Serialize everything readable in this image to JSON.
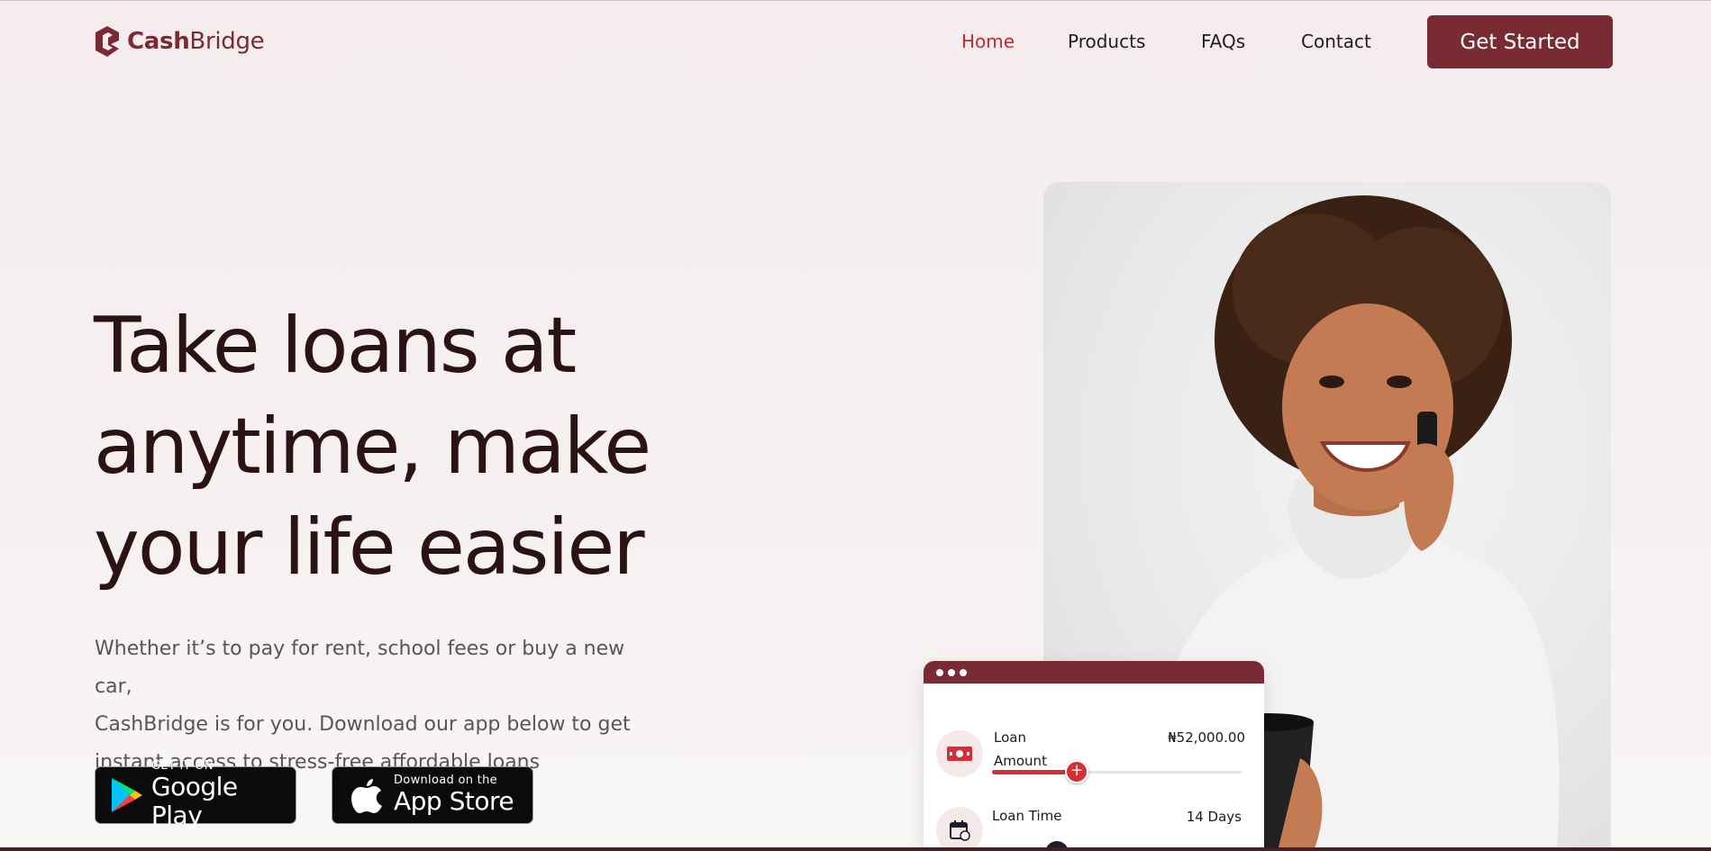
{
  "brand": {
    "bold": "Cash",
    "light": "Bridge"
  },
  "nav": {
    "items": [
      {
        "label": "Home",
        "active": true
      },
      {
        "label": "Products",
        "active": false
      },
      {
        "label": "FAQs",
        "active": false
      },
      {
        "label": "Contact",
        "active": false
      }
    ],
    "cta_label": "Get Started"
  },
  "hero": {
    "title_lines": [
      "Take loans at",
      "anytime, make",
      "your life easier"
    ],
    "subtitle_lines": [
      "Whether it’s to pay for rent, school fees or buy a new car,",
      "CashBridge is for you. Download our app below to get",
      "instant access to stress-free affordable loans"
    ]
  },
  "stores": {
    "google": {
      "small": "GET IT ON",
      "big": "Google Play"
    },
    "apple": {
      "small": "Download on the",
      "big": "App Store"
    }
  },
  "loan_card": {
    "loan_label": "Loan",
    "amount_label": "Amount",
    "amount_value": "₦52,000.00",
    "amount_fraction": 0.34,
    "time_label": "Loan Time",
    "time_value": "14 Days"
  },
  "colors": {
    "brand": "#7a2a33",
    "accent_red": "#c4282f",
    "title": "#2b1216",
    "background": "#f4eced"
  },
  "icons": [
    "logo-mark-icon",
    "cash-icon",
    "calendar-icon",
    "google-play-icon",
    "apple-icon",
    "plus-icon"
  ]
}
